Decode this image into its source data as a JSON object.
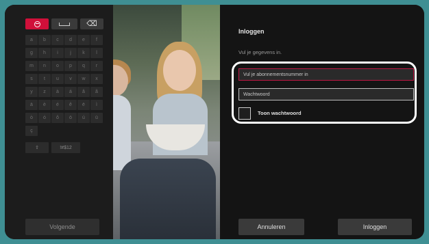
{
  "keyboard": {
    "top_keys": [
      {
        "name": "language-key",
        "icon": "globe-icon"
      },
      {
        "name": "space-key",
        "icon": "space-icon"
      },
      {
        "name": "backspace-key",
        "icon": "backspace-icon",
        "glyph": "⌫"
      }
    ],
    "rows": [
      [
        "a",
        "b",
        "c",
        "d",
        "e",
        "f"
      ],
      [
        "g",
        "h",
        "i",
        "j",
        "k",
        "l"
      ],
      [
        "m",
        "n",
        "o",
        "p",
        "q",
        "r"
      ],
      [
        "s",
        "t",
        "u",
        "v",
        "w",
        "x"
      ],
      [
        "y",
        "z",
        "à",
        "á",
        "â",
        "ã"
      ],
      [
        "ä",
        "è",
        "é",
        "ê",
        "ë",
        "ì"
      ],
      [
        "ò",
        "ó",
        "ô",
        "ö",
        "ú",
        "ü"
      ],
      [
        "ç"
      ]
    ],
    "shift_icon": "⇧",
    "symbols_label": "!#$12",
    "next_label": "Volgende"
  },
  "login": {
    "title": "Inloggen",
    "subtitle": "Vul je gegevens in.",
    "subscription_placeholder": "Vul je abonnementsnummer in",
    "password_placeholder": "Wachtwoord",
    "show_password_label": "Toon wachtwoord",
    "cancel_label": "Annuleren",
    "login_label": "Inloggen"
  },
  "colors": {
    "accent": "#d0103a",
    "background_frame": "#3f8f93"
  }
}
